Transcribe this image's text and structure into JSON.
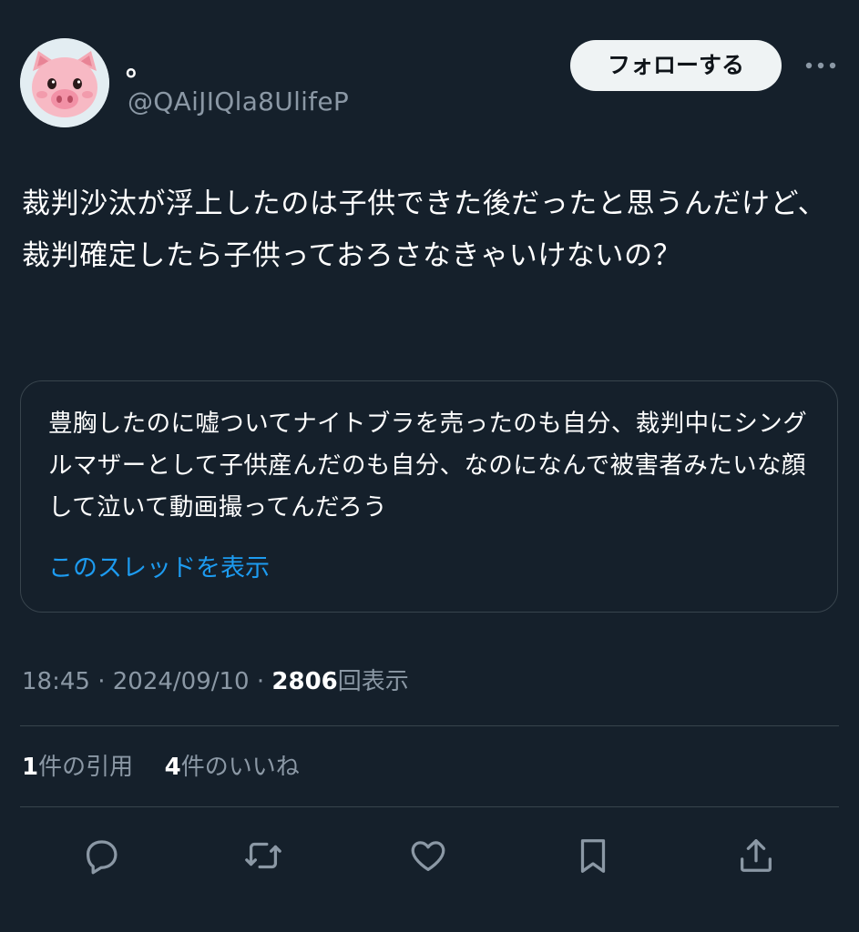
{
  "author": {
    "display_name": "。",
    "handle": "@QAiJIQla8UlifeP",
    "avatar_icon": "pig-face-avatar"
  },
  "header": {
    "follow_label": "フォローする",
    "more_icon": "more-dots-icon"
  },
  "tweet": {
    "text": "裁判沙汰が浮上したのは子供できた後だったと思うんだけど、裁判確定したら子供っておろさなきゃいけないの？"
  },
  "quote": {
    "text": "豊胸したのに嘘ついてナイトブラを売ったのも自分、裁判中にシングルマザーとして子供産んだのも自分、なのになんで被害者みたいな顔して泣いて動画撮ってんだろう",
    "show_thread_label": "このスレッドを表示"
  },
  "meta": {
    "time": "18:45",
    "separator": " · ",
    "date": "2024/09/10",
    "views_count": "2806",
    "views_label": "回表示"
  },
  "stats": {
    "quotes_count": "1",
    "quotes_label": "件の引用",
    "likes_count": "4",
    "likes_label": "件のいいね"
  },
  "actions": {
    "reply_icon": "reply-icon",
    "retweet_icon": "retweet-icon",
    "like_icon": "heart-icon",
    "bookmark_icon": "bookmark-icon",
    "share_icon": "share-icon"
  },
  "colors": {
    "background": "#15202b",
    "text_primary": "#ffffff",
    "text_secondary": "#8b98a5",
    "link": "#1d9bf0",
    "border": "#38444d",
    "follow_button_bg": "#eff3f4"
  }
}
